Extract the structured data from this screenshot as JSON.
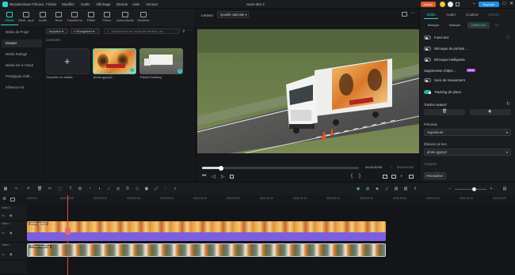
{
  "app": {
    "name": "Wondershare Filmora",
    "menu": [
      "Fichier",
      "Modifier",
      "Outils",
      "Affichage",
      "Étendu",
      "Aide",
      "Version"
    ],
    "project_title": "Sans titre 2",
    "activate_label": "Activer",
    "export_label": "Exporter",
    "window_controls": [
      "minimize-icon",
      "maximize-icon",
      "close-icon"
    ]
  },
  "media_tabs": [
    {
      "label": "Média",
      "icon": "media-icon"
    },
    {
      "label": "Médi...ique",
      "icon": "stock-media-icon"
    },
    {
      "label": "Audio",
      "icon": "audio-icon"
    },
    {
      "label": "Titres",
      "icon": "titles-icon"
    },
    {
      "label": "Transitions",
      "icon": "transitions-icon"
    },
    {
      "label": "Effets",
      "icon": "effects-icon"
    },
    {
      "label": "Filtres",
      "icon": "filters-icon"
    },
    {
      "label": "Autocollants",
      "icon": "stickers-icon"
    },
    {
      "label": "Modèles",
      "icon": "templates-icon"
    }
  ],
  "left_nav": [
    {
      "label": "Média de Projet"
    },
    {
      "label": "Dossier"
    },
    {
      "label": "Média Partagé"
    },
    {
      "label": "Média sur le Cloud"
    },
    {
      "label": "Protégique d'obf..."
    },
    {
      "label": "Influence Kit"
    }
  ],
  "media_toolbar": {
    "import_label": "Importer",
    "record_label": "Enregistrer",
    "search_placeholder": "Rechercher les noms de fichiers, de..."
  },
  "folder_label": "DOSSIER",
  "media_items": [
    {
      "label": "Importer un média"
    },
    {
      "label": "photo gypsy2"
    },
    {
      "label": "PlanerTracking"
    }
  ],
  "player": {
    "player_label": "Lecteur",
    "quality_label": "Qualité optimale",
    "current_time": "00:00:00:06",
    "total_time": "00:00:02:02",
    "progress": 0.12
  },
  "props": {
    "tabs": [
      "Vidéo",
      "Audio",
      "Couleur",
      "Vitesse"
    ],
    "subtabs": [
      "Basique",
      "Masque",
      "Outils d'IA",
      "Art"
    ],
    "items": [
      {
        "label": "Fond vert",
        "on": false
      },
      {
        "label": "Découpe de portrait ...",
        "on": false
      },
      {
        "label": "Découpe intelligente",
        "on": false
      },
      {
        "label": "Suppression d'objet ...",
        "on": false
      },
      {
        "label": "Suivi de mouvement",
        "on": false
      },
      {
        "label": "Tracking de plans",
        "on": true
      }
    ],
    "tracker_label": "Tracker avancé",
    "precision_label": "Précision",
    "precision_value": "Supérieure",
    "link_label": "Élément de lien",
    "link_value": "photo gypsy2",
    "analyze_label": "Analyser",
    "reset_label": "Réinitialiser",
    "new_badge": "NEW"
  },
  "timeline": {
    "ticks": [
      "00:00:00",
      "00:00:00:05",
      "00:00:00:10",
      "00:00:00:15",
      "00:00:00:20",
      "00:00:01:00",
      "00:00:01:05",
      "00:00:01:10",
      "00:00:01:15",
      "00:00:01:20",
      "00:00:02:00",
      "00:00:02:05",
      "00:00:02:10",
      "00:00:02:15",
      "00:00:02:20"
    ],
    "tracks": [
      {
        "label": "Vidéo 3"
      },
      {
        "label": "Vidéo 2"
      },
      {
        "label": "Vidéo 1"
      }
    ],
    "clip_top_label": "photo gypsy2",
    "clip_bottom_label": "PlanerTracking",
    "zoom": 0.6
  },
  "colors": {
    "accent": "#2fd3c6",
    "clip_purple": "#7c5fe0",
    "playhead": "#e54a4a",
    "activate": "#e05a2a",
    "export": "#1f8de6"
  }
}
